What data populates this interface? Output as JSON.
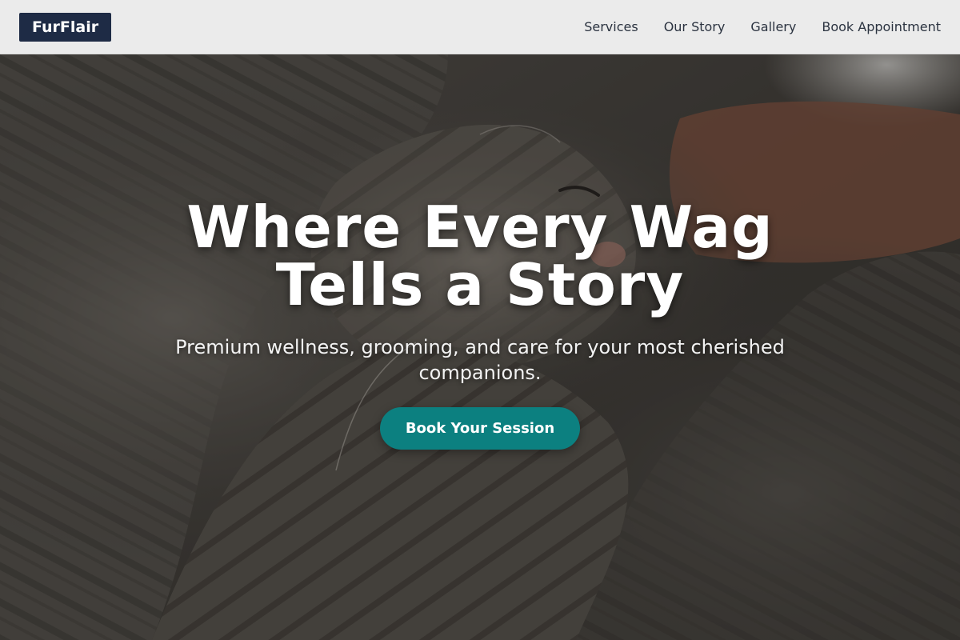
{
  "header": {
    "logo_text": "FurFlair",
    "nav": [
      {
        "label": "Services"
      },
      {
        "label": "Our Story"
      },
      {
        "label": "Gallery"
      },
      {
        "label": "Book Appointment"
      }
    ]
  },
  "hero": {
    "title_line1": "Where Every Wag",
    "title_line2": "Tells a Story",
    "subtitle": "Premium wellness, grooming, and care for your most cherished companions.",
    "cta_label": "Book Your Session",
    "background_subject": "two-sleeping-tabby-cats-photo"
  },
  "colors": {
    "header_bg": "#ebebeb",
    "logo_bg": "#1e2b45",
    "nav_text": "#2b3340",
    "cta_bg": "#0c8080",
    "hero_text": "#ffffff"
  }
}
